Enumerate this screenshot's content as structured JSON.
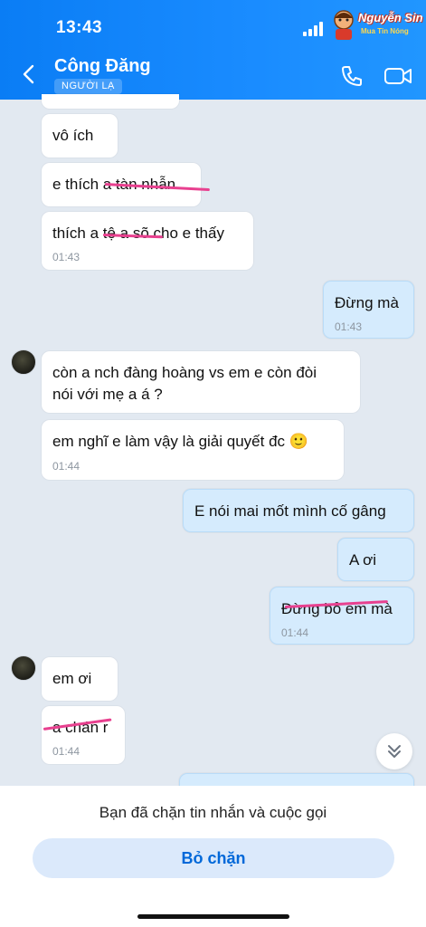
{
  "status_bar": {
    "time": "13:43"
  },
  "watermark": {
    "line1": "Nguyễn Sin",
    "line2": "Mua Tin Nóng"
  },
  "header": {
    "contact_name": "Công Đăng",
    "badge": "NGƯỜI LẠ",
    "call_icon": "phone-icon",
    "video_icon": "video-camera-icon"
  },
  "messages": [
    {
      "text": "vô ích",
      "time": ""
    },
    {
      "text": "e thích a tàn nhẫn",
      "time": ""
    },
    {
      "text": "thích a tệ a sõ cho e thấy",
      "time": "01:43"
    },
    {
      "text": "Đừng mà",
      "time": "01:43"
    },
    {
      "text_line1": "còn a nch đàng hoàng vs em e còn đòi",
      "text_line2": "nói với mẹ a á ?",
      "time": ""
    },
    {
      "text": "em nghĩ e làm vậy là giải quyết đc 🙂",
      "time": "01:44"
    },
    {
      "text": "E nói mai mốt mình cố gâng",
      "time": ""
    },
    {
      "text": "A ơi",
      "time": ""
    },
    {
      "text": "Đừng bỏ em mà",
      "time": "01:44"
    },
    {
      "text": "em ơi",
      "time": ""
    },
    {
      "text": "a chán r",
      "time": "01:44"
    }
  ],
  "footer": {
    "blocked_notice": "Bạn đã chặn tin nhắn và cuộc gọi",
    "unblock_label": "Bỏ chặn"
  },
  "colors": {
    "header": "#1a8cff",
    "outgoing_bubble": "#d5ebfd",
    "strike": "#e8408f",
    "accent": "#0068d9"
  }
}
